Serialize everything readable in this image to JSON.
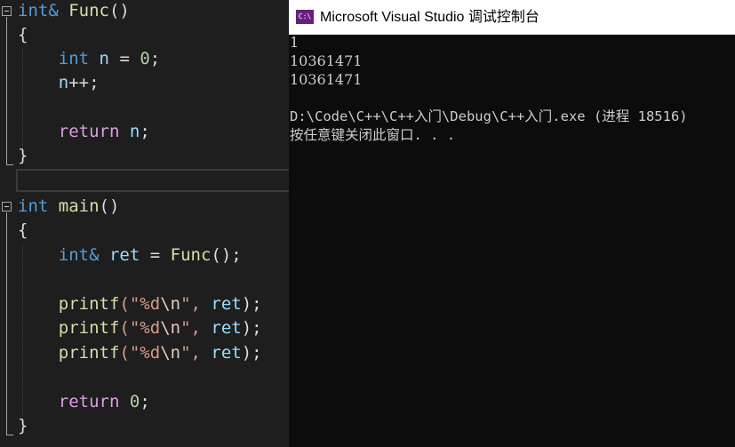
{
  "editor": {
    "func": {
      "ret_type": "int&",
      "name": "Func",
      "parens": "()",
      "open_brace": "{",
      "decl_type": "int",
      "decl_var": "n",
      "decl_rest": " = ",
      "decl_value": "0",
      "semicolon": ";",
      "incr_var": "n",
      "incr_op": "++;",
      "return_kw": "return",
      "return_var": "n",
      "close_brace": "}"
    },
    "main": {
      "ret_type": "int",
      "name": "main",
      "parens": "()",
      "open_brace": "{",
      "ref_type": "int&",
      "ref_var": "ret",
      "assign": " = ",
      "call_name": "Func",
      "call_rest": "();",
      "printf_name": "printf",
      "printf_open": "(\"",
      "fmt": "%d",
      "escape": "\\n",
      "printf_mid": "\", ",
      "arg": "ret",
      "printf_close": ");",
      "return_kw": "return",
      "return_value": "0",
      "close_brace": "}"
    }
  },
  "console": {
    "icon_label": "C:\\",
    "title": "Microsoft Visual Studio 调试控制台",
    "lines": [
      "1",
      "10361471",
      "10361471",
      "",
      "D:\\Code\\C++\\C++入门\\Debug\\C++入门.exe (进程 18516)",
      "按任意键关闭此窗口. . ."
    ]
  }
}
